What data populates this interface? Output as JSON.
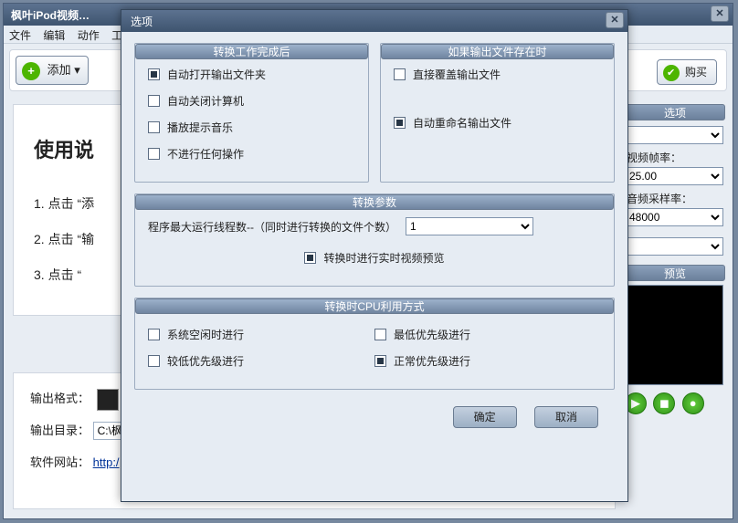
{
  "bgWindow": {
    "title": "枫叶iPod视频…",
    "menus": [
      "文件",
      "编辑",
      "动作",
      "工"
    ],
    "addBtn": "添加",
    "addArrow": "▾",
    "buyBtn": "购买",
    "instructTitle": "使用说",
    "steps": [
      "1. 点击 “添",
      "2. 点击 “输",
      "3. 点击 “"
    ]
  },
  "bottom": {
    "outFormatLabel": "输出格式：",
    "outDirLabel": "输出目录：",
    "outDirValue": "C:\\枫",
    "siteLabel": "软件网站：",
    "siteUrl": "http:/"
  },
  "right": {
    "optTitle": "选项",
    "fpsLabel": "视频帧率：",
    "fpsValue": "25.00",
    "srLabel": "音频采样率：",
    "srValue": "48000",
    "previewTitle": "预览"
  },
  "dialog": {
    "title": "选项",
    "group1Title": "转换工作完成后",
    "g1_opt1": "自动打开输出文件夹",
    "g1_opt2": "自动关闭计算机",
    "g1_opt3": "播放提示音乐",
    "g1_opt4": "不进行任何操作",
    "group2Title": "如果输出文件存在时",
    "g2_opt1": "直接覆盖输出文件",
    "g2_opt2": "自动重命名输出文件",
    "group3Title": "转换参数",
    "g3_label": "程序最大运行线程数--（同时进行转换的文件个数）",
    "g3_value": "1",
    "g3_chk": "转换时进行实时视频预览",
    "group4Title": "转换时CPU利用方式",
    "g4_opt1": "系统空闲时进行",
    "g4_opt2": "较低优先级进行",
    "g4_opt3": "最低优先级进行",
    "g4_opt4": "正常优先级进行",
    "okBtn": "确定",
    "cancelBtn": "取消"
  }
}
